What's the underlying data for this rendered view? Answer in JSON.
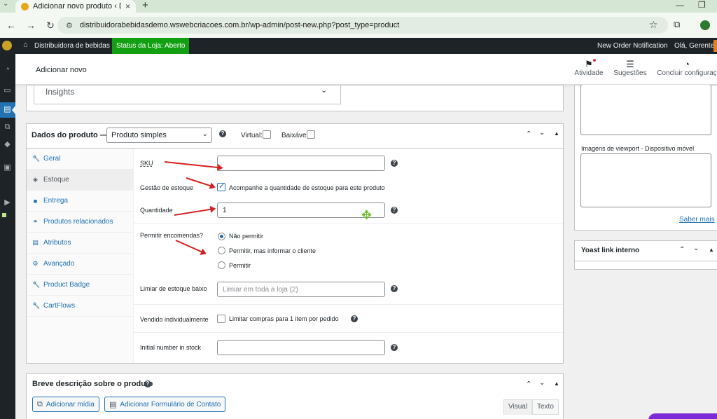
{
  "browser": {
    "tab_title": "Adicionar novo produto ‹ Distri",
    "tab_close": "×",
    "new_tab": "+",
    "url": "distribuidorabebidasdemo.wsweb​criacoes.com.br/wp-admin/post-new.php?post_type=product",
    "back": "←",
    "forward": "→",
    "reload": "↻",
    "minimize": "—",
    "restore": "❐"
  },
  "admin_bar": {
    "site_name": "Distribuidora de bebidas",
    "store_status": "Status da Loja: Aberto",
    "notification": "New Order Notification",
    "greeting": "Olá, Gerente",
    "status_color": "#12a012"
  },
  "wc_header": {
    "title": "Adicionar novo",
    "actions": [
      {
        "label": "Atividade",
        "icon": "flag-icon"
      },
      {
        "label": "Sugestões",
        "icon": "message-icon"
      },
      {
        "label": "Concluir configuraç",
        "icon": "progress-icon"
      }
    ]
  },
  "insights": {
    "label": "Insights"
  },
  "product_data": {
    "title": "Dados do produto —",
    "product_type": "Produto simples",
    "virtual_label": "Virtual:",
    "downloadable_label": "Baixável:",
    "tabs": [
      {
        "label": "Geral",
        "icon": "wrench-icon"
      },
      {
        "label": "Estoque",
        "icon": "tag-icon"
      },
      {
        "label": "Entrega",
        "icon": "truck-icon"
      },
      {
        "label": "Produtos relacionados",
        "icon": "link-icon"
      },
      {
        "label": "Atributos",
        "icon": "table-icon"
      },
      {
        "label": "Avançado",
        "icon": "gear-icon"
      },
      {
        "label": "Product Badge",
        "icon": "wrench-icon"
      },
      {
        "label": "CartFlows",
        "icon": "wrench-icon"
      }
    ],
    "active_tab": "Estoque",
    "fields": {
      "sku_label": "SKU",
      "sku_value": "",
      "stock_mgmt_label": "Gestão de estoque",
      "stock_mgmt_text": "Acompanhe a quantidade de estoque para este produto",
      "quantity_label": "Quantidade",
      "quantity_value": "1",
      "backorders_label": "Permitir encomendas?",
      "backorder_options": [
        "Não permitir",
        "Permitir, mas informar o cliente",
        "Permitir"
      ],
      "backorder_selected": "Não permitir",
      "low_stock_label": "Limiar de estoque baixo",
      "low_stock_placeholder": "Limiar em toda a loja (2)",
      "sold_individually_label": "Vendido individualmente",
      "sold_individually_text": "Limitar compras para 1 item por pedido",
      "initial_stock_label": "Initial number in stock",
      "initial_stock_value": ""
    }
  },
  "short_description": {
    "title": "Breve descrição sobre o produto",
    "add_media": "Adicionar mídia",
    "add_form": "Adicionar Formulário de Contato",
    "tab_visual": "Visual",
    "tab_text": "Texto"
  },
  "sidebar": {
    "viewport_label": "Imagens de viewport - Dispositivo móvel",
    "learn_more": "Saber mais",
    "yoast_title": "Yoast link interno"
  },
  "colors": {
    "accent": "#2271b1",
    "admin_bar": "#1d2327",
    "annotation_arrow": "#d32020"
  }
}
